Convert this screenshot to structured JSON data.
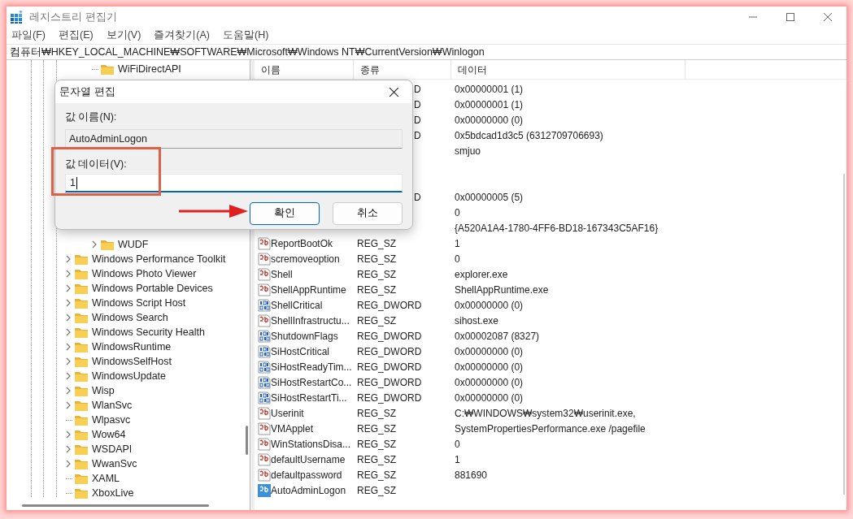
{
  "window": {
    "title": "레지스트리 편집기"
  },
  "menu": [
    "파일(F)",
    "편집(E)",
    "보기(V)",
    "즐겨찾기(A)",
    "도움말(H)"
  ],
  "address": "컴퓨터₩HKEY_LOCAL_MACHINE₩SOFTWARE₩Microsoft₩Windows NT₩CurrentVersion₩Winlogon",
  "tree": {
    "items": [
      {
        "children": [
          {
            "children": [
              {
                "label": "WiFiDirectAPI",
                "expandable": false
              },
              {
                "covered": true
              },
              {
                "covered": true
              },
              {
                "covered": true
              },
              {
                "covered": true
              },
              {
                "covered": true
              },
              {
                "covered": true
              },
              {
                "covered": true
              },
              {
                "covered": true
              },
              {
                "covered": true
              },
              {
                "covered": true
              },
              {
                "covered": true
              },
              {
                "label": "WUDF",
                "expandable": true
              }
            ]
          }
        ]
      },
      {
        "label": "Windows Performance Toolkit",
        "expandable": true
      },
      {
        "label": "Windows Photo Viewer",
        "expandable": true
      },
      {
        "label": "Windows Portable Devices",
        "expandable": true
      },
      {
        "label": "Windows Script Host",
        "expandable": true
      },
      {
        "label": "Windows Search",
        "expandable": true
      },
      {
        "label": "Windows Security Health",
        "expandable": true
      },
      {
        "label": "WindowsRuntime",
        "expandable": true
      },
      {
        "label": "WindowsSelfHost",
        "expandable": true
      },
      {
        "label": "WindowsUpdate",
        "expandable": true
      },
      {
        "label": "Wisp",
        "expandable": true
      },
      {
        "label": "WlanSvc",
        "expandable": true
      },
      {
        "label": "Wlpasvc",
        "expandable": false
      },
      {
        "label": "Wow64",
        "expandable": true
      },
      {
        "label": "WSDAPI",
        "expandable": true
      },
      {
        "label": "WwanSvc",
        "expandable": true
      },
      {
        "label": "XAML",
        "expandable": false
      },
      {
        "label": "XboxLive",
        "expandable": false
      }
    ]
  },
  "table": {
    "columns": [
      "이름",
      "종류",
      "데이터"
    ],
    "rows": [
      {
        "covered": true,
        "type": "D",
        "data": "0x00000001 (1)"
      },
      {
        "covered": true,
        "type": "D",
        "data": "0x00000001 (1)"
      },
      {
        "covered": true,
        "type": "D",
        "data": "0x00000000 (0)"
      },
      {
        "covered": true,
        "type": "D",
        "data": "0x5bdcad1d3c5 (6312709706693)"
      },
      {
        "covered": true,
        "data": "smjuo"
      },
      {
        "covered": true
      },
      {
        "covered": true
      },
      {
        "covered": true,
        "type": "D",
        "data": "0x00000005 (5)"
      },
      {
        "covered": true,
        "data": "0"
      },
      {
        "covered": true,
        "data": "{A520A1A4-1780-4FF6-BD18-167343C5AF16}"
      },
      {
        "kind": "sz",
        "name": "ReportBootOk",
        "type": "REG_SZ",
        "data": "1",
        "selected": false
      },
      {
        "kind": "sz",
        "name": "scremoveoption",
        "type": "REG_SZ",
        "data": "0",
        "selected": false
      },
      {
        "kind": "sz",
        "name": "Shell",
        "type": "REG_SZ",
        "data": "explorer.exe",
        "selected": false
      },
      {
        "kind": "sz",
        "name": "ShellAppRuntime",
        "type": "REG_SZ",
        "data": "ShellAppRuntime.exe",
        "selected": false
      },
      {
        "kind": "dword",
        "name": "ShellCritical",
        "type": "REG_DWORD",
        "data": "0x00000000 (0)",
        "selected": false
      },
      {
        "kind": "sz",
        "name": "ShellInfrastructu...",
        "type": "REG_SZ",
        "data": "sihost.exe",
        "selected": false
      },
      {
        "kind": "dword",
        "name": "ShutdownFlags",
        "type": "REG_DWORD",
        "data": "0x00002087 (8327)",
        "selected": false
      },
      {
        "kind": "dword",
        "name": "SiHostCritical",
        "type": "REG_DWORD",
        "data": "0x00000000 (0)",
        "selected": false
      },
      {
        "kind": "dword",
        "name": "SiHostReadyTim...",
        "type": "REG_DWORD",
        "data": "0x00000000 (0)",
        "selected": false
      },
      {
        "kind": "dword",
        "name": "SiHostRestartCo...",
        "type": "REG_DWORD",
        "data": "0x00000000 (0)",
        "selected": false
      },
      {
        "kind": "dword",
        "name": "SiHostRestartTi...",
        "type": "REG_DWORD",
        "data": "0x00000000 (0)",
        "selected": false
      },
      {
        "kind": "sz",
        "name": "Userinit",
        "type": "REG_SZ",
        "data": "C:₩WINDOWS₩system32₩userinit.exe,",
        "selected": false
      },
      {
        "kind": "sz",
        "name": "VMApplet",
        "type": "REG_SZ",
        "data": "SystemPropertiesPerformance.exe /pagefile",
        "selected": false
      },
      {
        "kind": "sz",
        "name": "WinStationsDisa...",
        "type": "REG_SZ",
        "data": "0",
        "selected": false
      },
      {
        "kind": "sz",
        "name": "defaultUsername",
        "type": "REG_SZ",
        "data": "1",
        "selected": false
      },
      {
        "kind": "sz",
        "name": "defaultpassword",
        "type": "REG_SZ",
        "data": "881690",
        "selected": false
      },
      {
        "kind": "sz",
        "name": "AutoAdminLogon",
        "type": "REG_SZ",
        "selected": true
      }
    ]
  },
  "dialog": {
    "title": "문자열 편집",
    "name_label": "값 이름(N):",
    "name_value": "AutoAdminLogon",
    "data_label": "값 데이터(V):",
    "data_value": "1",
    "buttons": [
      {
        "label": "확인",
        "primary": true
      },
      {
        "label": "취소",
        "primary": false
      }
    ]
  }
}
